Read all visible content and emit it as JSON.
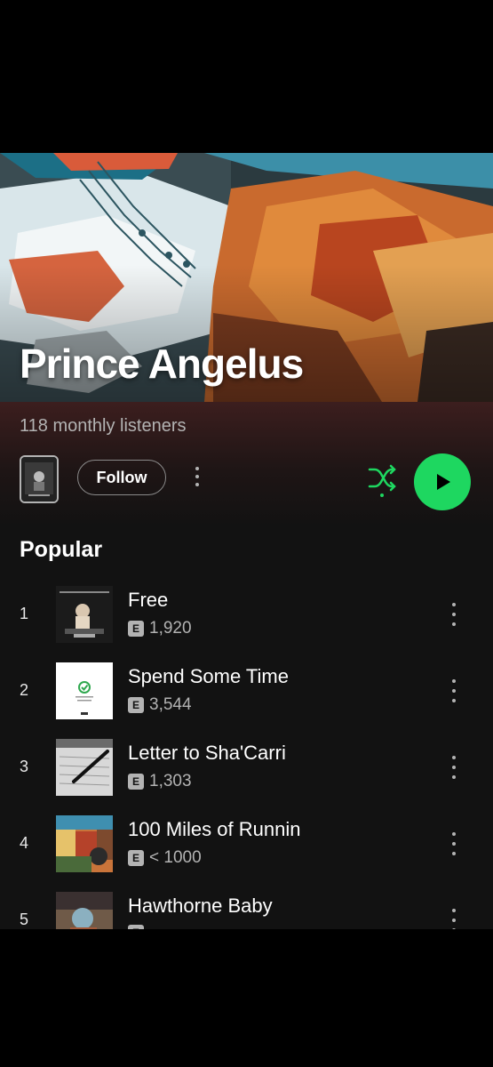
{
  "artist": {
    "name": "Prince Angelus",
    "monthly_listeners": "118 monthly listeners"
  },
  "actions": {
    "follow_label": "Follow",
    "shuffle_icon": "shuffle-icon",
    "play_icon": "play-icon",
    "accent_color": "#1ed760"
  },
  "popular": {
    "title": "Popular",
    "tracks": [
      {
        "number": "1",
        "title": "Free",
        "explicit": "E",
        "plays": "1,920"
      },
      {
        "number": "2",
        "title": "Spend Some Time",
        "explicit": "E",
        "plays": "3,544"
      },
      {
        "number": "3",
        "title": "Letter to Sha'Carri",
        "explicit": "E",
        "plays": "1,303"
      },
      {
        "number": "4",
        "title": "100 Miles of Runnin",
        "explicit": "E",
        "plays": "< 1000"
      },
      {
        "number": "5",
        "title": "Hawthorne Baby",
        "explicit": "E",
        "plays": ""
      }
    ]
  }
}
